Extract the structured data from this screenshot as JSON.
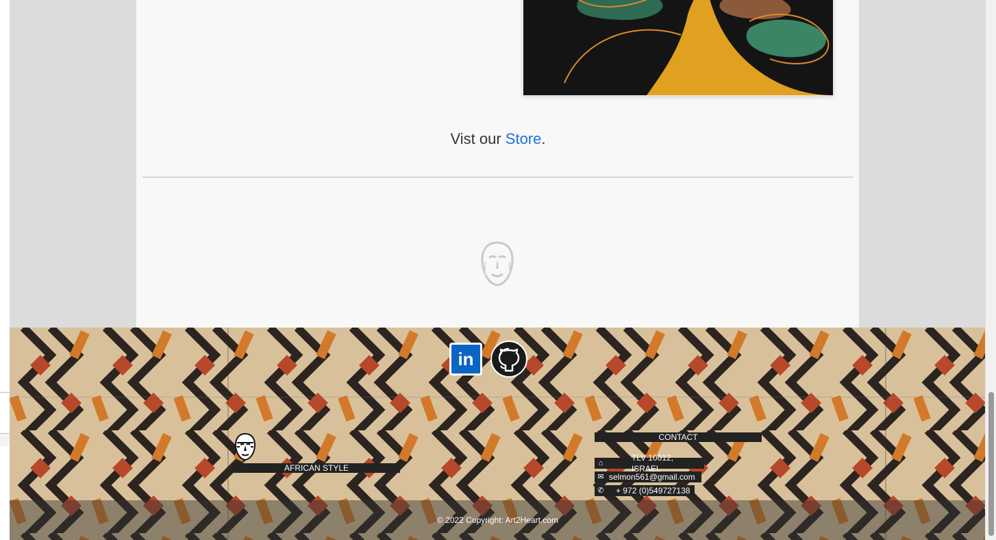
{
  "store_line": {
    "prefix": "Vist our ",
    "link": "Store",
    "suffix": "."
  },
  "social": {
    "linkedin_label": "in"
  },
  "footer": {
    "brand_title": "AFRICAN STYLE",
    "contact_title": "CONTACT",
    "contact": {
      "address": "TLV 10012, ISRAEL",
      "email": "selmon561@gmail.com",
      "phone": "+ 972 (0)549727138"
    },
    "copyright": "© 2022 Copyright: Art2Heart.com"
  },
  "icons": {
    "home": "home-icon",
    "email": "envelope-icon",
    "phone": "phone-icon",
    "linkedin": "linkedin-icon",
    "github": "github-icon",
    "mask": "african-mask-icon"
  },
  "colors": {
    "link": "#1a73d9",
    "linkedin": "#0a66c2",
    "page_bg": "#dcdcdc",
    "card_bg": "#f8f8f8"
  }
}
